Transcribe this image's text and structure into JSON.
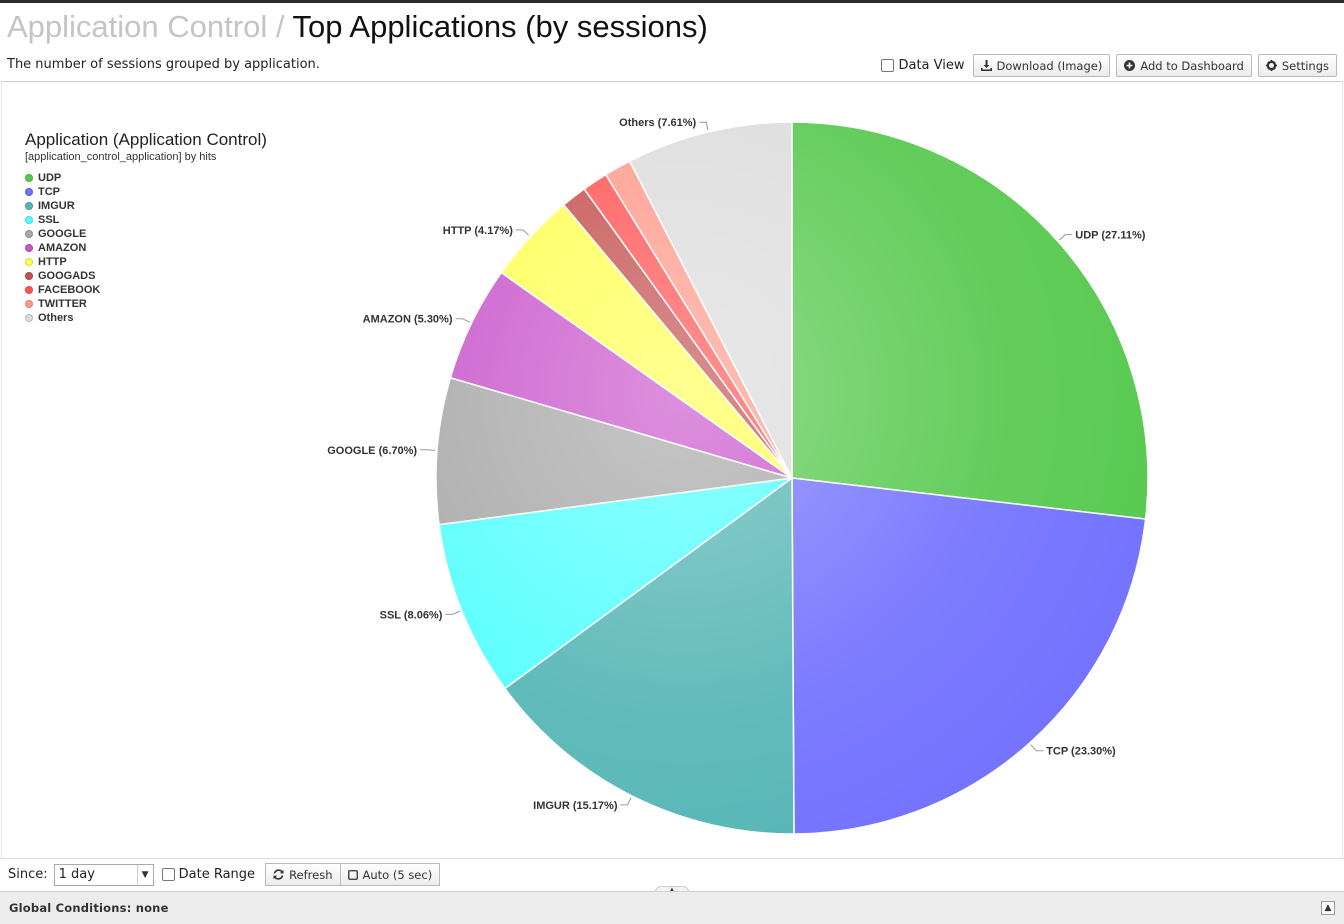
{
  "header": {
    "breadcrumb": "Application Control",
    "separator": "/",
    "title": "Top Applications (by sessions)",
    "description": "The number of sessions grouped by application."
  },
  "toolbar": {
    "data_view_label": "Data View",
    "download_label": "Download (Image)",
    "add_dashboard_label": "Add to Dashboard",
    "settings_label": "Settings",
    "icons": [
      "download-icon",
      "plus-circle-icon",
      "gear-icon"
    ]
  },
  "legend": {
    "title": "Application (Application Control)",
    "subtitle": "[application_control_application] by hits"
  },
  "chart_data": {
    "type": "pie",
    "categories": [
      "UDP",
      "TCP",
      "IMGUR",
      "SSL",
      "GOOGLE",
      "AMAZON",
      "HTTP",
      "GOOGADS",
      "FACEBOOK",
      "TWITTER",
      "Others"
    ],
    "values": [
      27.11,
      23.3,
      15.17,
      8.06,
      6.7,
      5.3,
      4.17,
      1.17,
      1.17,
      1.24,
      7.61
    ],
    "labels": [
      "UDP (27.11%)",
      "TCP (23.30%)",
      "IMGUR (15.17%)",
      "SSL (8.06%)",
      "GOOGLE (6.70%)",
      "AMAZON (5.30%)",
      "HTTP (4.17%)",
      "",
      "",
      "",
      "Others (7.61%)"
    ],
    "colors": [
      "#56c94e",
      "#7171ff",
      "#55b5b5",
      "#55ffff",
      "#a8a8a8",
      "#c955cc",
      "#ffff55",
      "#c45050",
      "#ff5555",
      "#ff9a8c",
      "#dcdcdc"
    ],
    "title": "",
    "legend_placement": "top-left"
  },
  "footer": {
    "since_label": "Since:",
    "since_value": "1 day",
    "date_range_label": "Date Range",
    "refresh_label": "Refresh",
    "auto_label": "Auto (5 sec)"
  },
  "global": {
    "conditions_text": "Global Conditions: none"
  }
}
